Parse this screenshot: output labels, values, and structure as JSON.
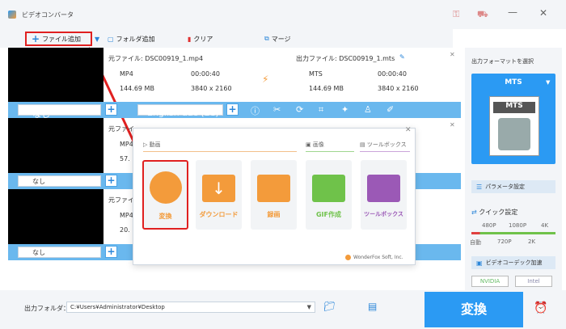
{
  "titlebar": {
    "app_title": "ビデオコンバータ"
  },
  "toolbar": {
    "add_file": "ファイル追加",
    "add_folder": "フォルダ追加",
    "clear": "クリア",
    "merge": "マージ"
  },
  "rows": [
    {
      "input_file": "元ファイル: DSC00919_1.mp4",
      "output_file": "出力ファイル: DSC00919_1.mts",
      "in_format": "MP4",
      "in_duration": "00:00:40",
      "in_size": "144.69 MB",
      "in_res": "3840 x 2160",
      "out_format": "MTS",
      "out_duration": "00:00:40",
      "out_size": "144.69 MB",
      "out_res": "3840 x 2160",
      "subtitle": "なし",
      "audio": "English aac (LC)"
    },
    {
      "input_file": "元ファイ",
      "in_format": "MP4",
      "in_size": "57.",
      "subtitle": "なし"
    },
    {
      "input_file": "元ファイ",
      "in_format": "MP4",
      "in_size": "20.",
      "subtitle": "なし"
    }
  ],
  "popup": {
    "group_video": "動画",
    "group_image": "画像",
    "group_toolbox": "ツールボックス",
    "tiles": [
      "変換",
      "ダウンロード",
      "録画",
      "GIF作成",
      "ツールボックス"
    ],
    "brand": "WonderFox Soft, Inc."
  },
  "right": {
    "select_format": "出力フォーマットを選択",
    "format": "MTS",
    "param": "パラメータ設定",
    "quick": "クイック設定",
    "q_top": [
      "480P",
      "1080P",
      "4K"
    ],
    "q_bottom": [
      "自動",
      "720P",
      "2K"
    ],
    "accel": "ビデオコーデック加速",
    "nvidia": "NVIDIA",
    "intel": "Intel"
  },
  "bottom": {
    "folder_label": "出力フォルダ：",
    "folder_path": "C:¥Users¥Administrator¥Desktop",
    "convert": "変換"
  },
  "colors": {
    "accent": "#2b9af3",
    "highlight": "#e02020",
    "orange": "#f39b3b",
    "green": "#6fc24a",
    "purple": "#9b59b6"
  }
}
